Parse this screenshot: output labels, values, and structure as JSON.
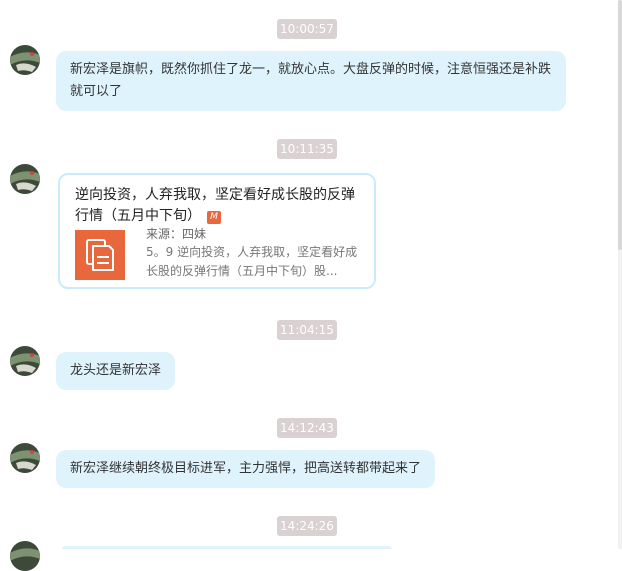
{
  "messages": [
    {
      "time": "10:00:57",
      "text": "新宏泽是旗帜，既然你抓住了龙一，就放心点。大盘反弹的时候，注意恒强还是补跌就可以了"
    },
    {
      "time": "10:11:35",
      "card": {
        "title": "逆向投资，人弃我取，坚定看好成长股的反弹行情（五月中下旬）",
        "badge": "M",
        "source": "来源：四妹",
        "desc": "5。9 逆向投资，人弃我取，坚定看好成长股的反弹行情（五月中下旬）股..."
      }
    },
    {
      "time": "11:04:15",
      "text": "龙头还是新宏泽"
    },
    {
      "time": "14:12:43",
      "text": "新宏泽继续朝终极目标进军，主力强悍，把高送转都带起来了"
    },
    {
      "time": "14:24:26"
    }
  ],
  "icons": {
    "avatar": "avatar-image",
    "card_thumb": "document-icon",
    "card_badge": "article-badge-icon"
  },
  "colors": {
    "bubble_bg": "#dff3fd",
    "timestamp_bg": "#d9d1d2",
    "card_border": "#c9ecfb",
    "card_thumb": "#e8673d"
  }
}
